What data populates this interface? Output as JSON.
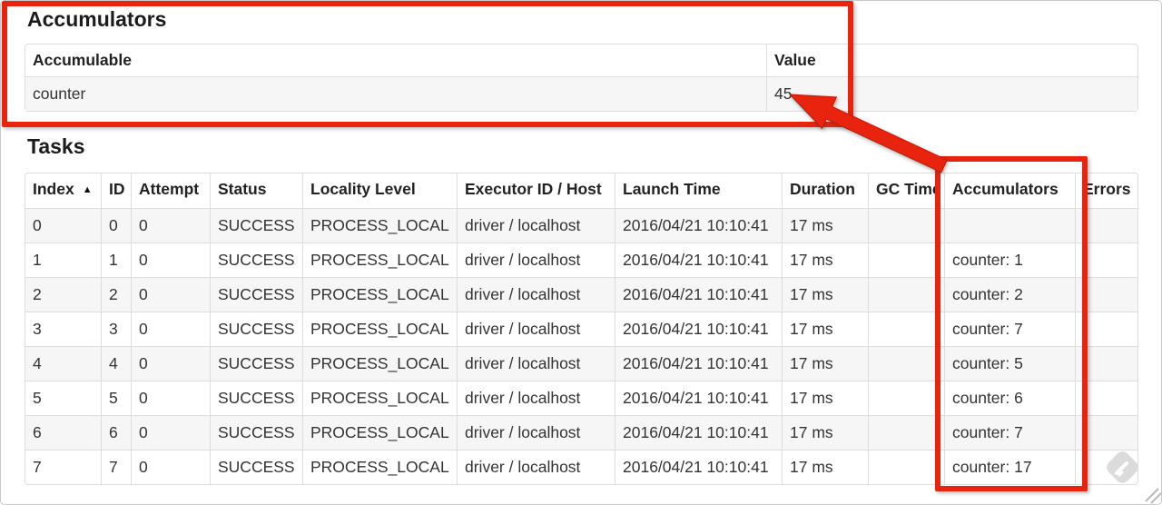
{
  "accumulators_section": {
    "title": "Accumulators",
    "table": {
      "headers": [
        "Accumulable",
        "Value"
      ],
      "rows": [
        [
          "counter",
          "45"
        ]
      ]
    }
  },
  "tasks_section": {
    "title": "Tasks",
    "table": {
      "sort_icon": "▲",
      "headers": [
        "Index",
        "ID",
        "Attempt",
        "Status",
        "Locality Level",
        "Executor ID / Host",
        "Launch Time",
        "Duration",
        "GC Time",
        "Accumulators",
        "Errors"
      ],
      "rows": [
        [
          "0",
          "0",
          "0",
          "SUCCESS",
          "PROCESS_LOCAL",
          "driver / localhost",
          "2016/04/21 10:10:41",
          "17 ms",
          "",
          "",
          ""
        ],
        [
          "1",
          "1",
          "0",
          "SUCCESS",
          "PROCESS_LOCAL",
          "driver / localhost",
          "2016/04/21 10:10:41",
          "17 ms",
          "",
          "counter: 1",
          ""
        ],
        [
          "2",
          "2",
          "0",
          "SUCCESS",
          "PROCESS_LOCAL",
          "driver / localhost",
          "2016/04/21 10:10:41",
          "17 ms",
          "",
          "counter: 2",
          ""
        ],
        [
          "3",
          "3",
          "0",
          "SUCCESS",
          "PROCESS_LOCAL",
          "driver / localhost",
          "2016/04/21 10:10:41",
          "17 ms",
          "",
          "counter: 7",
          ""
        ],
        [
          "4",
          "4",
          "0",
          "SUCCESS",
          "PROCESS_LOCAL",
          "driver / localhost",
          "2016/04/21 10:10:41",
          "17 ms",
          "",
          "counter: 5",
          ""
        ],
        [
          "5",
          "5",
          "0",
          "SUCCESS",
          "PROCESS_LOCAL",
          "driver / localhost",
          "2016/04/21 10:10:41",
          "17 ms",
          "",
          "counter: 6",
          ""
        ],
        [
          "6",
          "6",
          "0",
          "SUCCESS",
          "PROCESS_LOCAL",
          "driver / localhost",
          "2016/04/21 10:10:41",
          "17 ms",
          "",
          "counter: 7",
          ""
        ],
        [
          "7",
          "7",
          "0",
          "SUCCESS",
          "PROCESS_LOCAL",
          "driver / localhost",
          "2016/04/21 10:10:41",
          "17 ms",
          "",
          "counter: 17",
          ""
        ]
      ]
    }
  },
  "annotations": {
    "color": "#e8230e",
    "shapes": [
      "accumulators-summary-box",
      "tasks-accumulators-column-box",
      "arrow-pointing-to-value-45"
    ]
  },
  "icons": {
    "sort_ascending": "sort-ascending-triangle",
    "watermark": "feedly-logo",
    "corner": "resize-grip"
  }
}
